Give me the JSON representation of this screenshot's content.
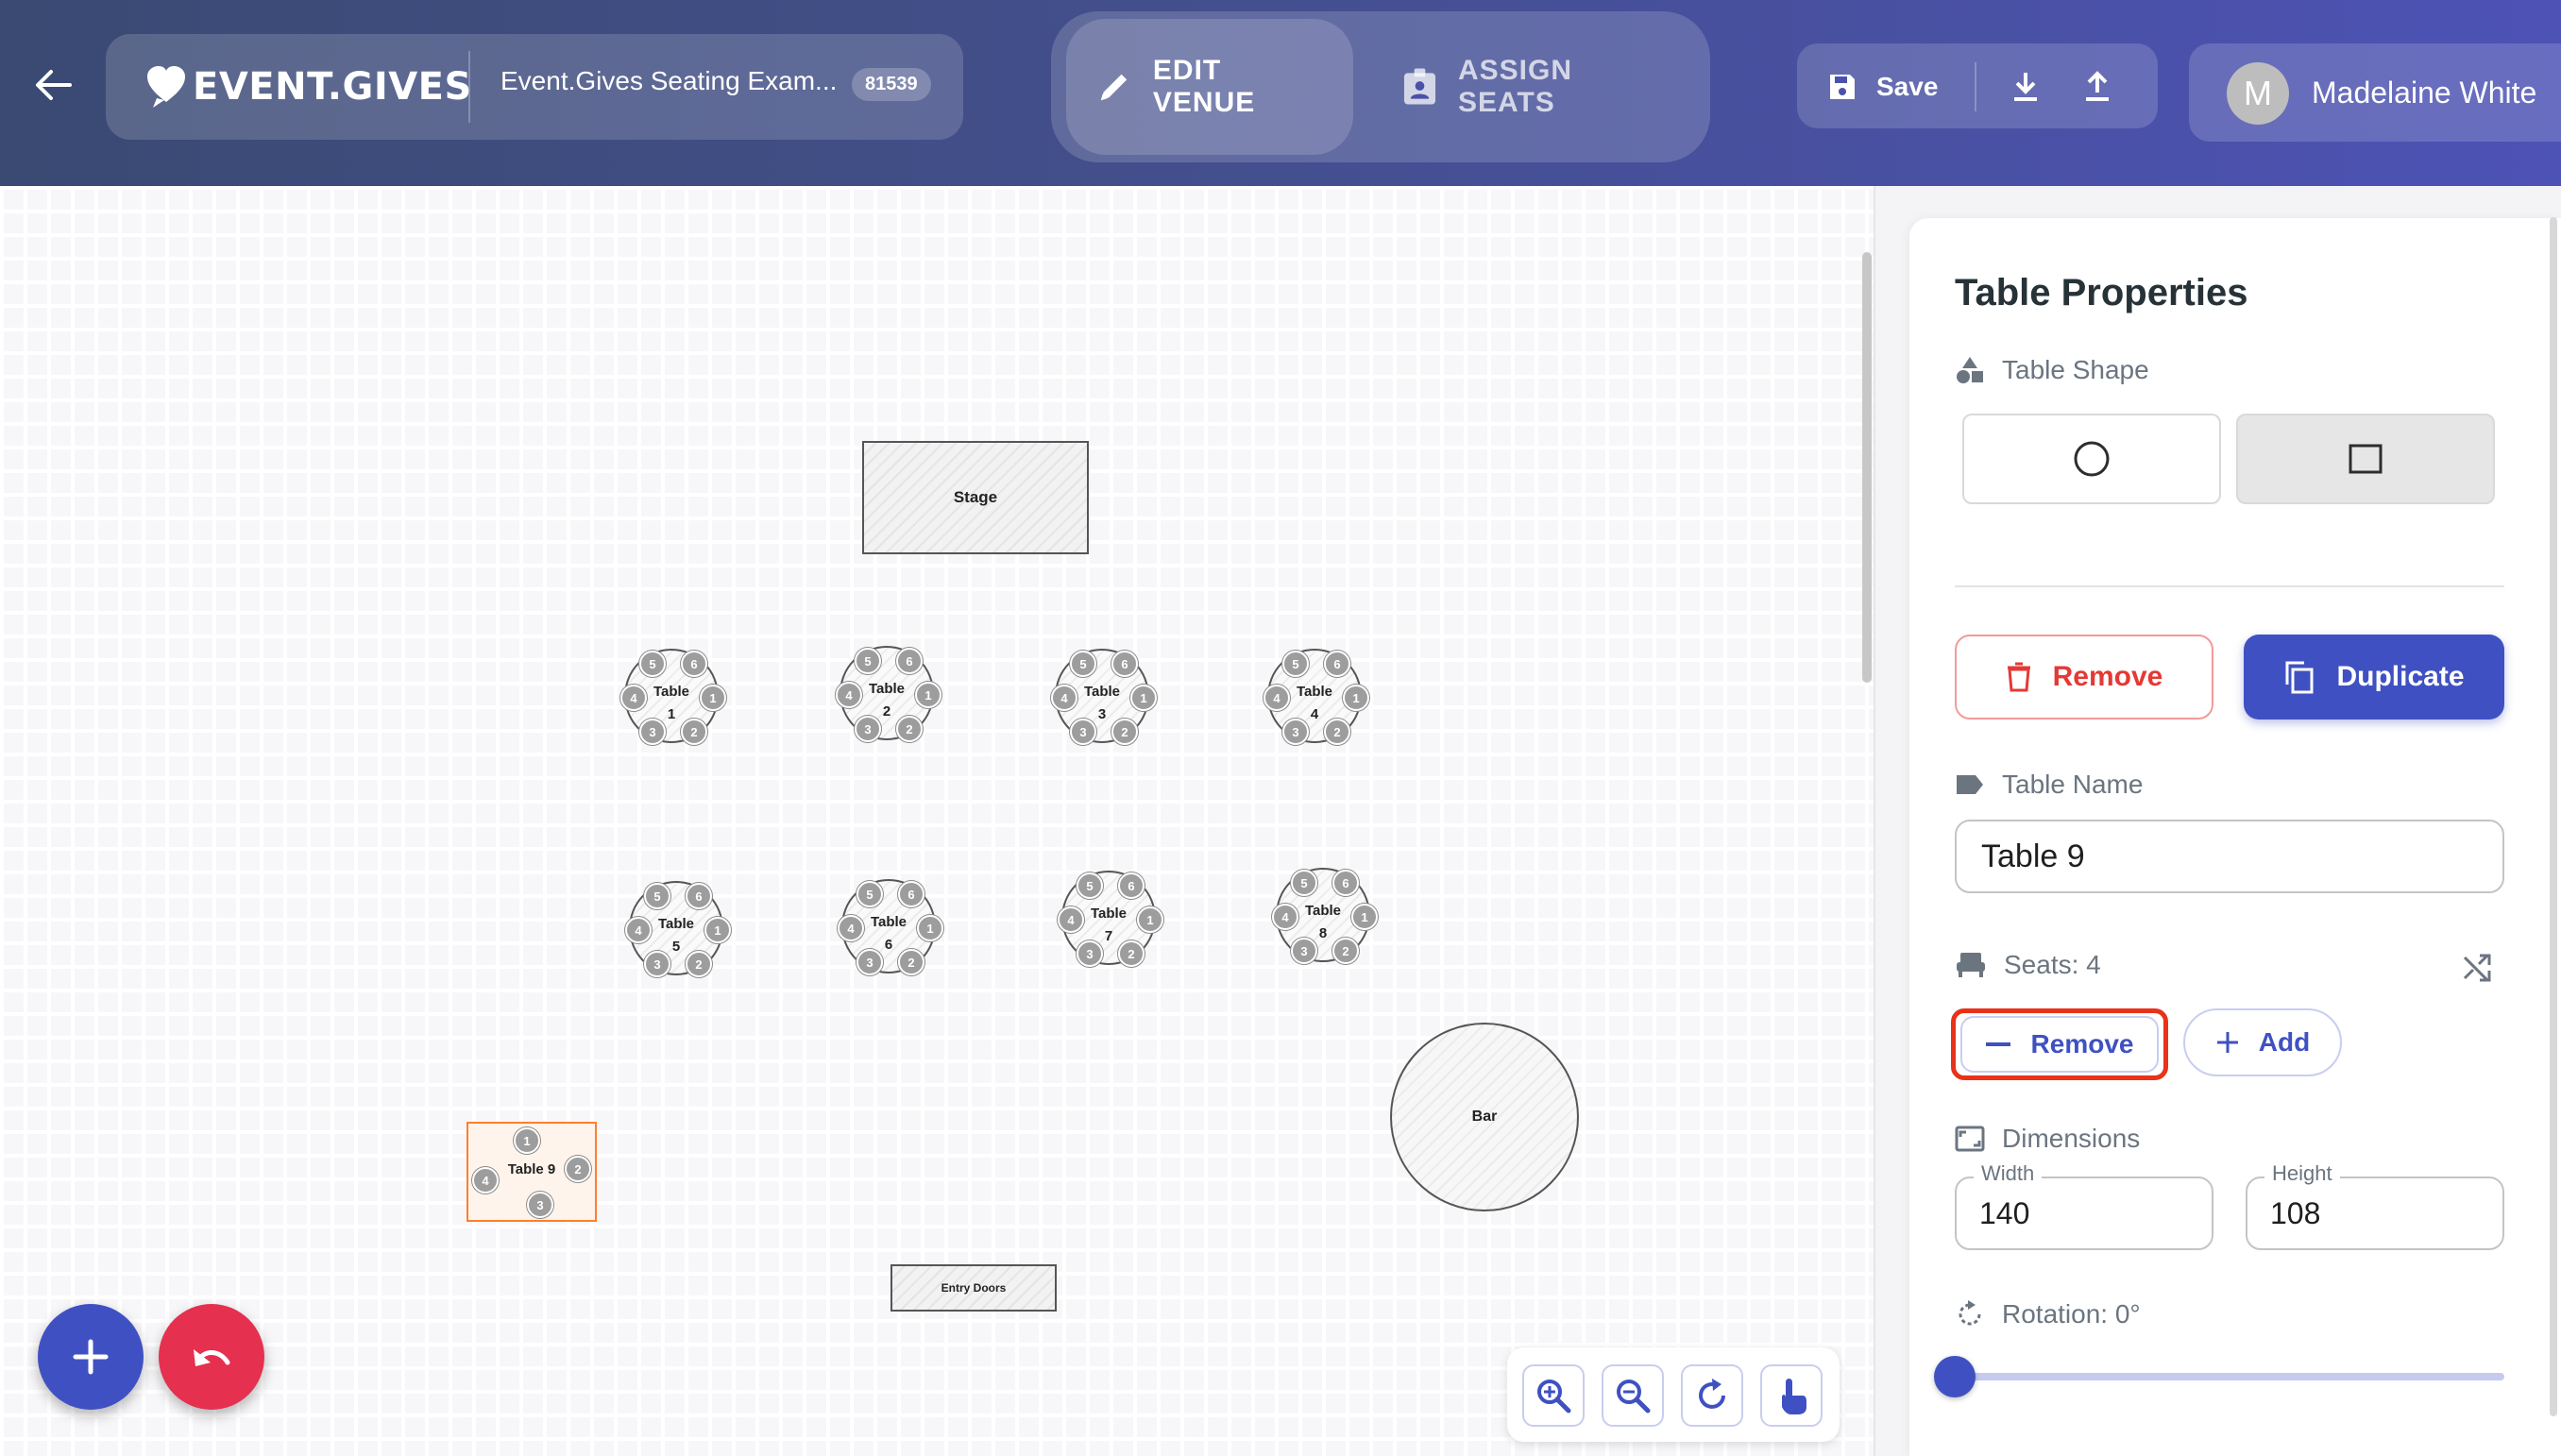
{
  "header": {
    "brand": "EVENT.GIVES",
    "event_title": "Event.Gives Seating Exam...",
    "event_id": "81539",
    "modes": {
      "edit": "EDIT VENUE",
      "assign": "ASSIGN SEATS",
      "active": "edit"
    },
    "save_label": "Save",
    "user": {
      "initial": "M",
      "name": "Madelaine White"
    }
  },
  "canvas": {
    "stage_label": "Stage",
    "bar_label": "Bar",
    "entry_label": "Entry Doors",
    "round_tables": [
      {
        "word": "Table",
        "num": "1",
        "seats": [
          "1",
          "2",
          "3",
          "4",
          "5",
          "6"
        ]
      },
      {
        "word": "Table",
        "num": "2",
        "seats": [
          "1",
          "2",
          "3",
          "4",
          "5",
          "6"
        ]
      },
      {
        "word": "Table",
        "num": "3",
        "seats": [
          "1",
          "2",
          "3",
          "4",
          "5",
          "6"
        ]
      },
      {
        "word": "Table",
        "num": "4",
        "seats": [
          "1",
          "2",
          "3",
          "4",
          "5",
          "6"
        ]
      },
      {
        "word": "Table",
        "num": "5",
        "seats": [
          "1",
          "2",
          "3",
          "4",
          "5",
          "6"
        ]
      },
      {
        "word": "Table",
        "num": "6",
        "seats": [
          "1",
          "2",
          "3",
          "4",
          "5",
          "6"
        ]
      },
      {
        "word": "Table",
        "num": "7",
        "seats": [
          "1",
          "2",
          "3",
          "4",
          "5",
          "6"
        ]
      },
      {
        "word": "Table",
        "num": "8",
        "seats": [
          "1",
          "2",
          "3",
          "4",
          "5",
          "6"
        ]
      }
    ],
    "selected_table": {
      "name": "Table 9",
      "seats": [
        "1",
        "2",
        "3",
        "4"
      ]
    }
  },
  "panel": {
    "title": "Table Properties",
    "shape_label": "Table Shape",
    "shape_selected": "square",
    "remove_label": "Remove",
    "duplicate_label": "Duplicate",
    "name_label": "Table Name",
    "name_value": "Table 9",
    "seats_label": "Seats: 4",
    "seat_remove_label": "Remove",
    "seat_add_label": "Add",
    "dimensions_label": "Dimensions",
    "width_label": "Width",
    "width_value": "140",
    "height_label": "Height",
    "height_value": "108",
    "rotation_label": "Rotation: 0°",
    "rotation_value": 0
  },
  "colors": {
    "primary": "#3f51c2",
    "danger": "#e53935",
    "selection": "#ff7f2a",
    "highlight_ring": "#e8321a"
  }
}
